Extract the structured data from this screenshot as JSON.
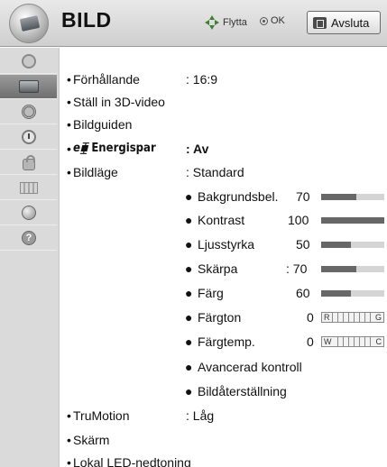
{
  "header": {
    "title": "BILD",
    "nav_hint": "Flytta",
    "ok_hint": "OK",
    "exit_label": "Avsluta"
  },
  "sidebar": {
    "items": [
      {
        "icon": "picture-globe-icon"
      },
      {
        "icon": "tv-picture-icon",
        "active": true
      },
      {
        "icon": "speaker-icon"
      },
      {
        "icon": "clock-icon"
      },
      {
        "icon": "lock-icon"
      },
      {
        "icon": "option-icon"
      },
      {
        "icon": "network-icon"
      },
      {
        "icon": "help-icon"
      }
    ]
  },
  "menu": {
    "aspect_label": "Förhållande",
    "aspect_value": ": 16:9",
    "3d_label": "Ställ in 3D-video",
    "guide_label": "Bildguiden",
    "energy_prefix": "e⧯",
    "energy_label": "Energispar",
    "energy_value": ": Av",
    "mode_label": "Bildläge",
    "mode_value": ": Standard",
    "backlight_label": "Bakgrundsbel.",
    "backlight_value": "70",
    "contrast_label": "Kontrast",
    "contrast_value": "100",
    "brightness_label": "Ljusstyrka",
    "brightness_value": "50",
    "sharpness_label": "Skärpa",
    "sharpness_value": ": 70",
    "color_label": "Färg",
    "color_value": "60",
    "tint_label": "Färgton",
    "tint_value": "0",
    "tint_left": "R",
    "tint_right": "G",
    "temp_label": "Färgtemp.",
    "temp_value": "0",
    "temp_left": "W",
    "temp_right": "C",
    "advanced_label": "Avancerad kontroll",
    "reset_label": "Bildåterställning",
    "trumotion_label": "TruMotion",
    "trumotion_value": ": Låg",
    "screen_label": "Skärm",
    "led_label": "Lokal LED-nedtoning"
  },
  "levels": {
    "backlight": 0.55,
    "contrast": 1.0,
    "brightness": 0.47,
    "sharpness": 0.55,
    "color": 0.47
  }
}
